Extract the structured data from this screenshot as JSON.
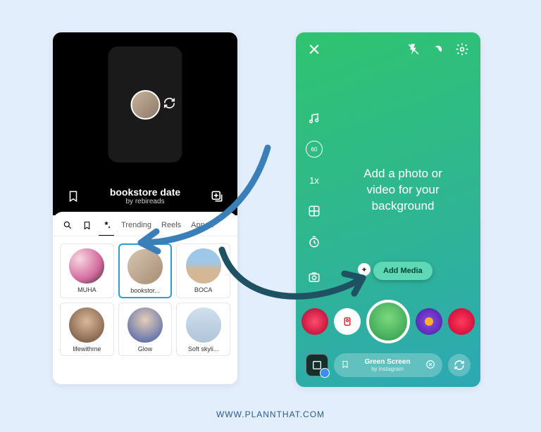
{
  "left": {
    "template": {
      "title": "bookstore date",
      "author": "by rebireads"
    },
    "tabs": {
      "trending": "Trending",
      "reels": "Reels",
      "appearance": "Appea"
    },
    "templates": [
      {
        "label": "MUHA"
      },
      {
        "label": "bookstor..."
      },
      {
        "label": "BOCA"
      },
      {
        "label": "lifewithme"
      },
      {
        "label": "Glow"
      },
      {
        "label": "Soft skyli..."
      }
    ]
  },
  "right": {
    "speed": "1x",
    "duration": "60",
    "prompt_line1": "Add a photo or",
    "prompt_line2": "video for your",
    "prompt_line3": "background",
    "add_media_label": "Add Media",
    "effect": {
      "name": "Green Screen",
      "by": "by instagram"
    }
  },
  "footer": "WWW.PLANNTHAT.COM"
}
